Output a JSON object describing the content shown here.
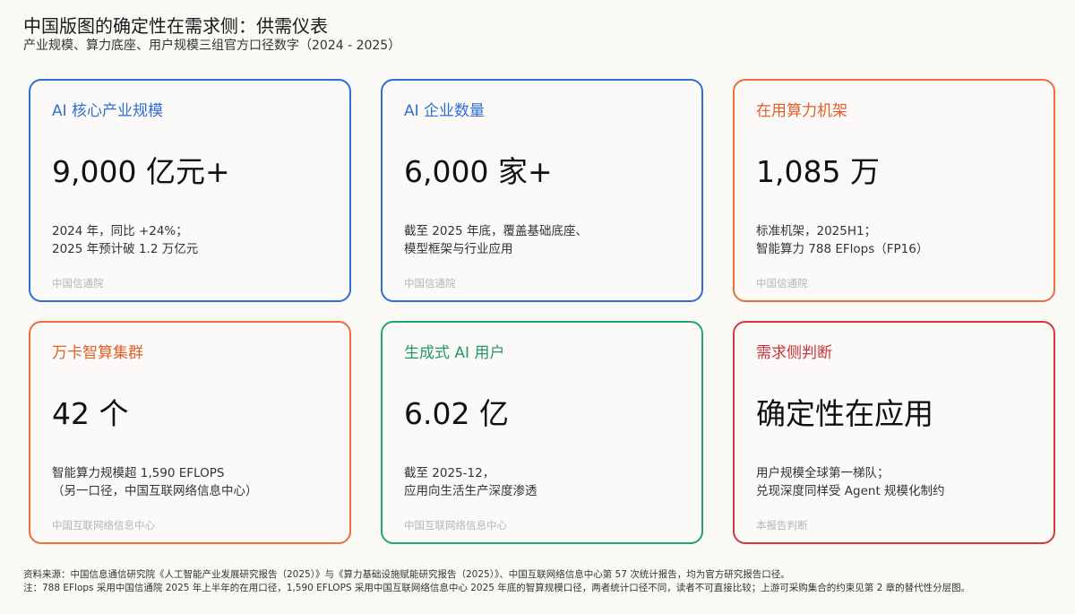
{
  "header": {
    "title": "中国版图的确定性在需求侧：供需仪表",
    "subtitle": "产业规模、算力底座、用户规模三组官方口径数字（2024 - 2025）"
  },
  "cards": [
    {
      "label": "AI 核心产业规模",
      "value": "9,000 亿元+",
      "desc": [
        "2024 年，同比 +24%；",
        "2025 年预计破 1.2 万亿元"
      ],
      "source": "中国信通院",
      "color": "#2f6fd1"
    },
    {
      "label": "AI 企业数量",
      "value": "6,000 家+",
      "desc": [
        "截至 2025 年底，覆盖基础底座、",
        "模型框架与行业应用"
      ],
      "source": "中国信通院",
      "color": "#2f6fd1"
    },
    {
      "label": "在用算力机架",
      "value": "1,085 万",
      "desc": [
        "标准机架，2025H1；",
        "智能算力 788 EFlops（FP16）"
      ],
      "source": "中国信通院",
      "color": "#e8703a"
    },
    {
      "label": "万卡智算集群",
      "value": "42 个",
      "desc": [
        "智能算力规模超 1,590 EFLOPS",
        "（另一口径，中国互联网络信息中心）"
      ],
      "source": "中国互联网络信息中心",
      "color": "#e8703a"
    },
    {
      "label": "生成式 AI 用户",
      "value": "6.02 亿",
      "desc": [
        "截至 2025-12，",
        "应用向生活生产深度渗透"
      ],
      "source": "中国互联网络信息中心",
      "color": "#23a56c"
    },
    {
      "label": "需求侧判断",
      "value": "确定性在应用",
      "desc": [
        "用户规模全球第一梯队；",
        "兑现深度同样受 Agent 规模化制约"
      ],
      "source": "本报告判断",
      "color": "#d2383d"
    }
  ],
  "footer": {
    "line1": "资料来源：中国信息通信研究院《人工智能产业发展研究报告（2025）》与《算力基础设施赋能研究报告（2025）》、中国互联网络信息中心第 57 次统计报告，均为官方研究报告口径。",
    "line2": "注：788 EFlops 采用中国信通院 2025 年上半年的在用口径，1,590 EFLOPS 采用中国互联网络信息中心 2025 年底的智算规模口径，两者统计口径不同，读者不可直接比较；上游可采购集合的约束见第 2 章的替代性分层图。"
  }
}
